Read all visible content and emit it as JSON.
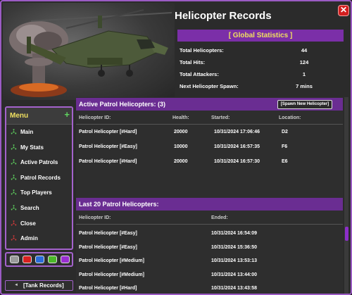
{
  "window": {
    "title": "Helicopter Records"
  },
  "stats": {
    "header": "[ Global Statistics ]",
    "rows": [
      {
        "label": "Total Helicopters:",
        "value": "44"
      },
      {
        "label": "Total Hits:",
        "value": "124"
      },
      {
        "label": "Total Attackers:",
        "value": "1"
      },
      {
        "label": "Next Helicopter Spawn:",
        "value": "7 mins"
      }
    ]
  },
  "menu": {
    "title": "Menu",
    "plus": "+",
    "items": [
      {
        "label": "Main",
        "icon": "radiation-icon",
        "color": "#5fd35f"
      },
      {
        "label": "My Stats",
        "icon": "radiation-icon",
        "color": "#5fd35f"
      },
      {
        "label": "Active Patrols",
        "icon": "radiation-icon",
        "color": "#5fd35f"
      },
      {
        "label": "Patrol Records",
        "icon": "radiation-icon",
        "color": "#5fd35f"
      },
      {
        "label": "Top Players",
        "icon": "radiation-icon",
        "color": "#5fd35f"
      },
      {
        "label": "Search",
        "icon": "radiation-icon",
        "color": "#5fd35f"
      },
      {
        "label": "Close",
        "icon": "radiation-icon",
        "color": "#d63a3a"
      },
      {
        "label": "Admin",
        "icon": "radiation-icon",
        "color": "#d63a3a"
      }
    ]
  },
  "swatches": [
    "#9a9a9a",
    "#d92020",
    "#2a6bd9",
    "#4cb82a",
    "#9a2ed1"
  ],
  "tank_button": {
    "label": "[Tank Records]",
    "arrow": "◄"
  },
  "active": {
    "title": "Active Patrol Helicopters: (3)",
    "spawn_label": "[Spawn New Helicopter]",
    "columns": [
      "Helicopter ID:",
      "Health:",
      "Started:",
      "Location:"
    ],
    "rows": [
      [
        "Patrol Helicopter [#Hard]",
        "20000",
        "10/31/2024 17:06:46",
        "D2"
      ],
      [
        "Patrol Helicopter [#Easy]",
        "10000",
        "10/31/2024 16:57:35",
        "F6"
      ],
      [
        "Patrol Helicopter [#Hard]",
        "20000",
        "10/31/2024 16:57:30",
        "E6"
      ]
    ]
  },
  "history": {
    "title": "Last 20 Patrol Helicopters:",
    "columns": [
      "Helicopter ID:",
      "Ended:"
    ],
    "rows": [
      [
        "Patrol Helicopter [#Easy]",
        "10/31/2024 16:54:09"
      ],
      [
        "Patrol Helicopter [#Easy]",
        "10/31/2024 15:36:50"
      ],
      [
        "Patrol Helicopter [#Medium]",
        "10/31/2024 13:53:13"
      ],
      [
        "Patrol Helicopter [#Medium]",
        "10/31/2024 13:44:00"
      ],
      [
        "Patrol Helicopter [#Hard]",
        "10/31/2024 13:43:58"
      ]
    ]
  }
}
